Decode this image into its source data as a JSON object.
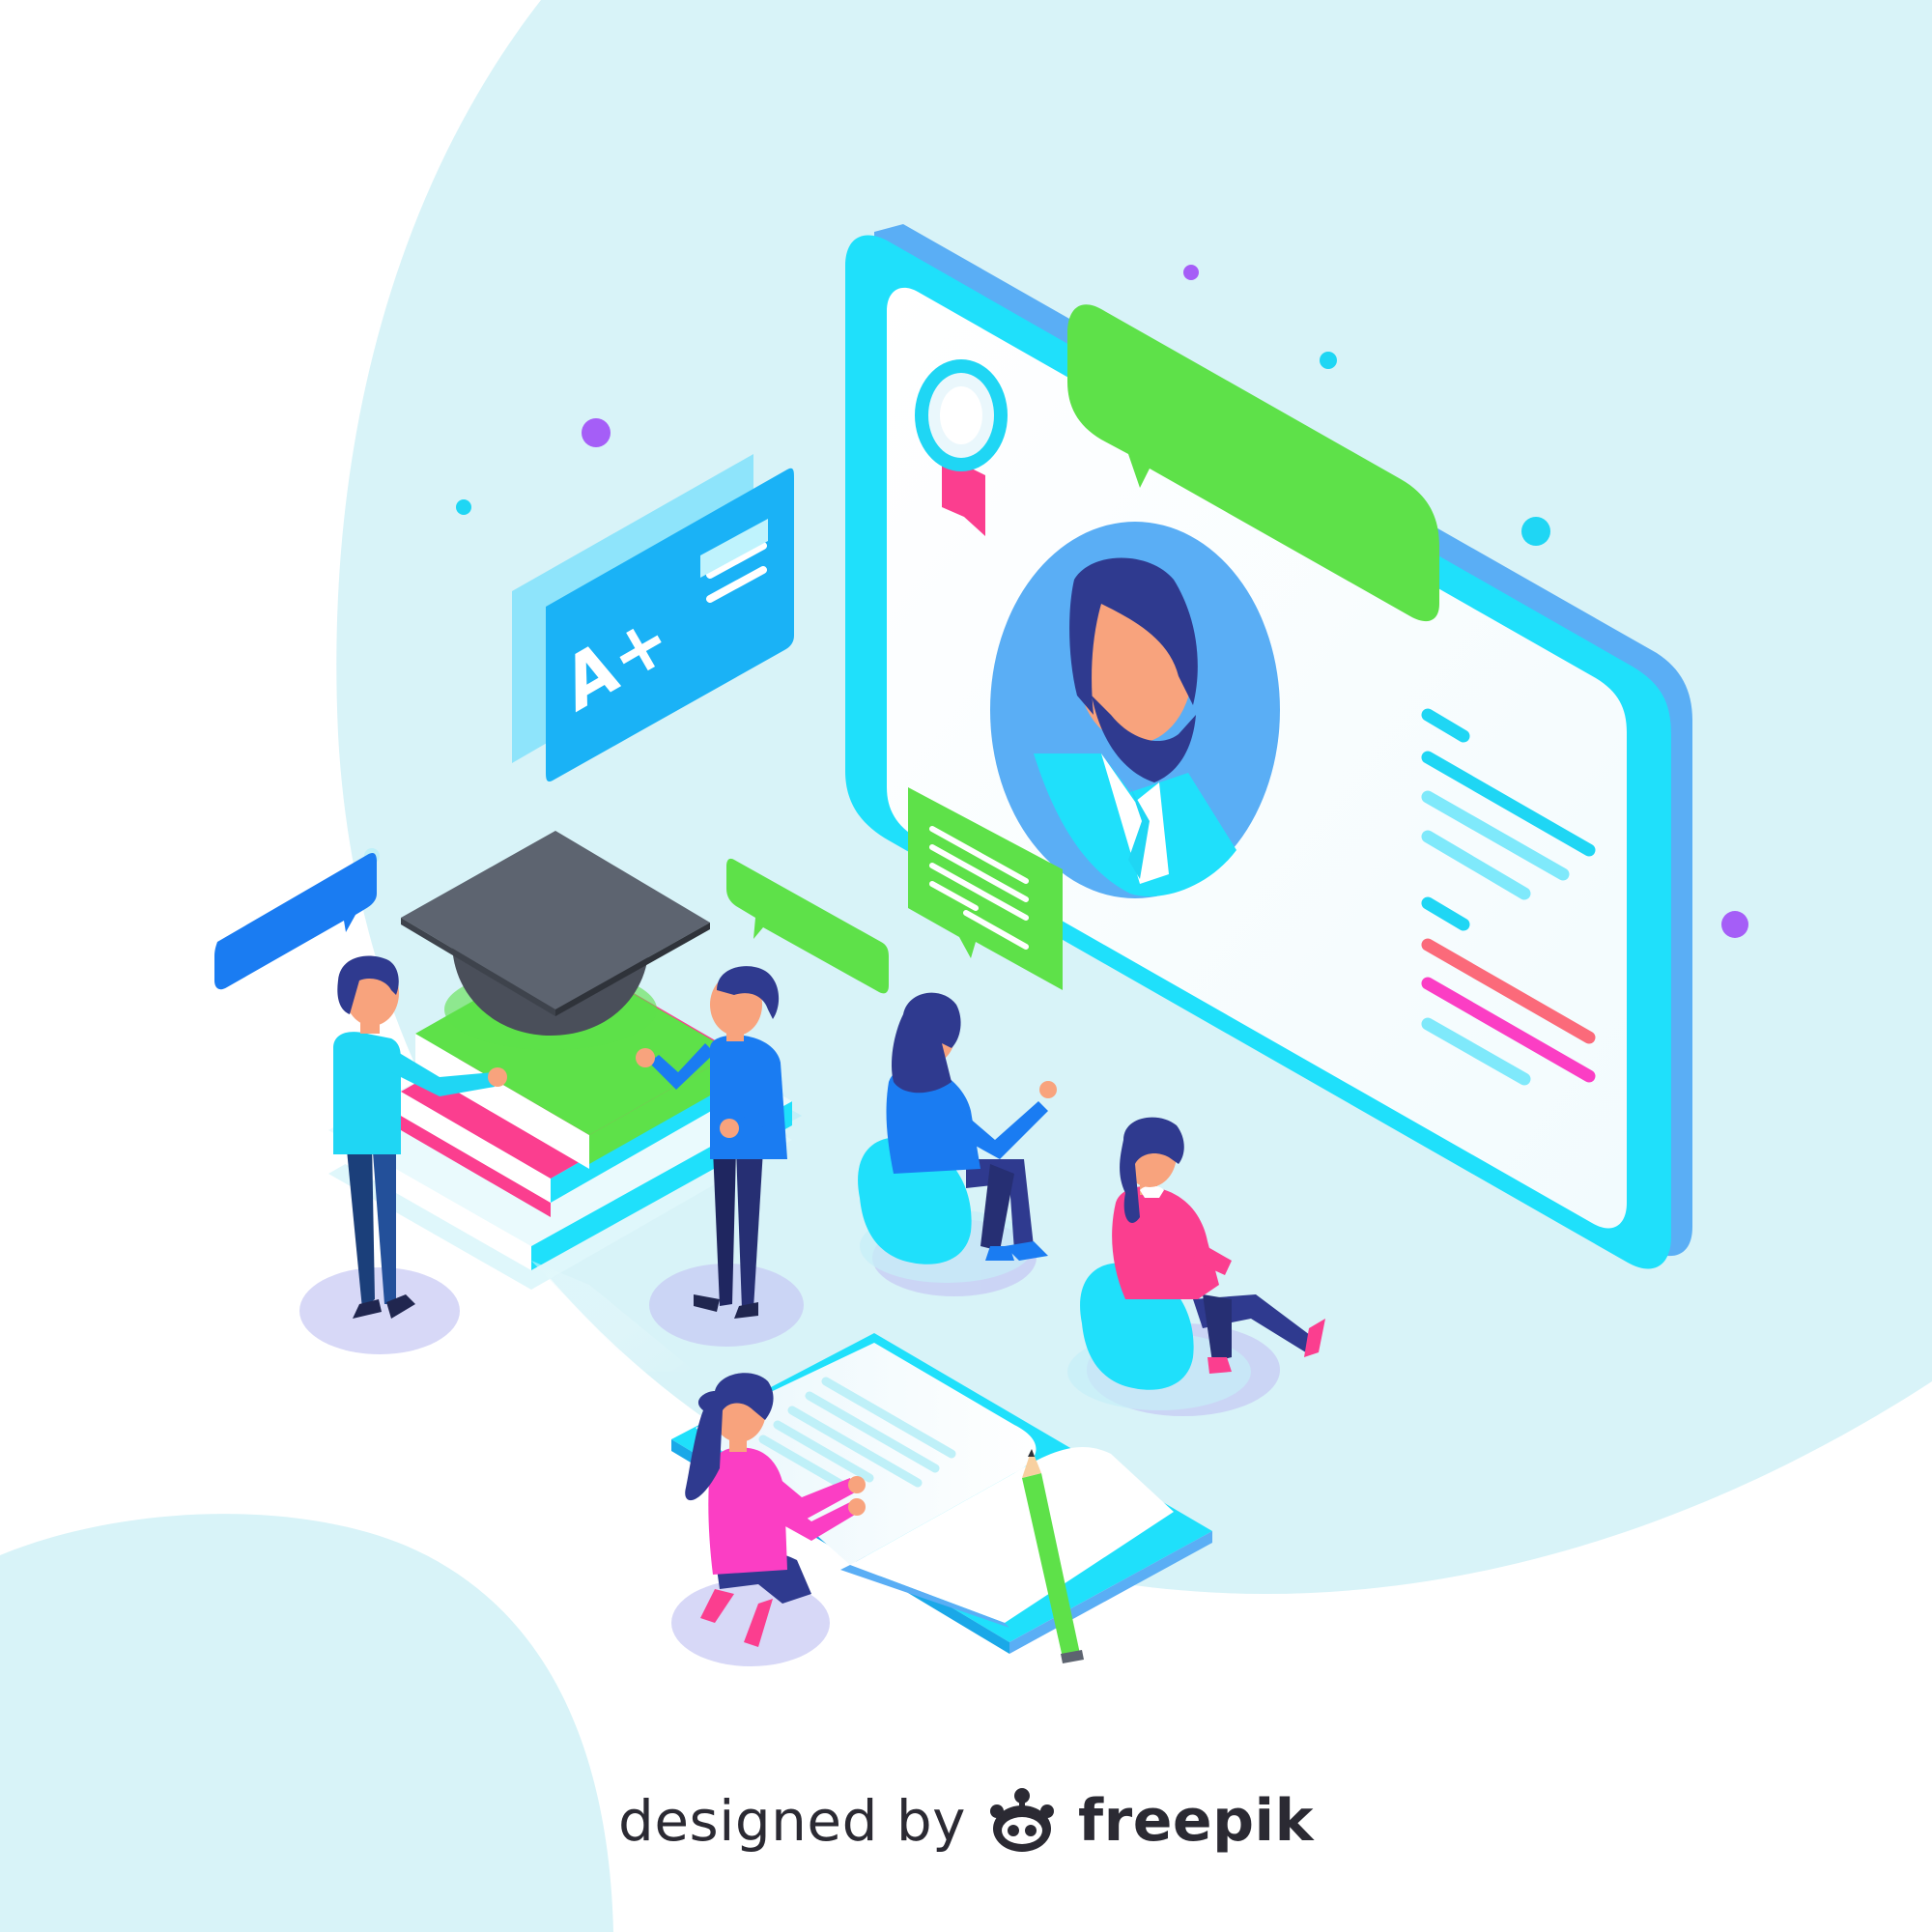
{
  "illustration": {
    "theme": "online education / e-learning",
    "colors": {
      "background_blob": "#d8f3f8",
      "screen_frame": "#1fe0fb",
      "screen_side": "#5aaef5",
      "green_bubble": "#5ee149",
      "blue_card": "#1ab2f6",
      "pink": "#fb3e8f",
      "navy": "#2f3a8f"
    },
    "grade_card_text": "A+"
  },
  "credit": {
    "prefix": "designed by",
    "brand": "freepik"
  }
}
